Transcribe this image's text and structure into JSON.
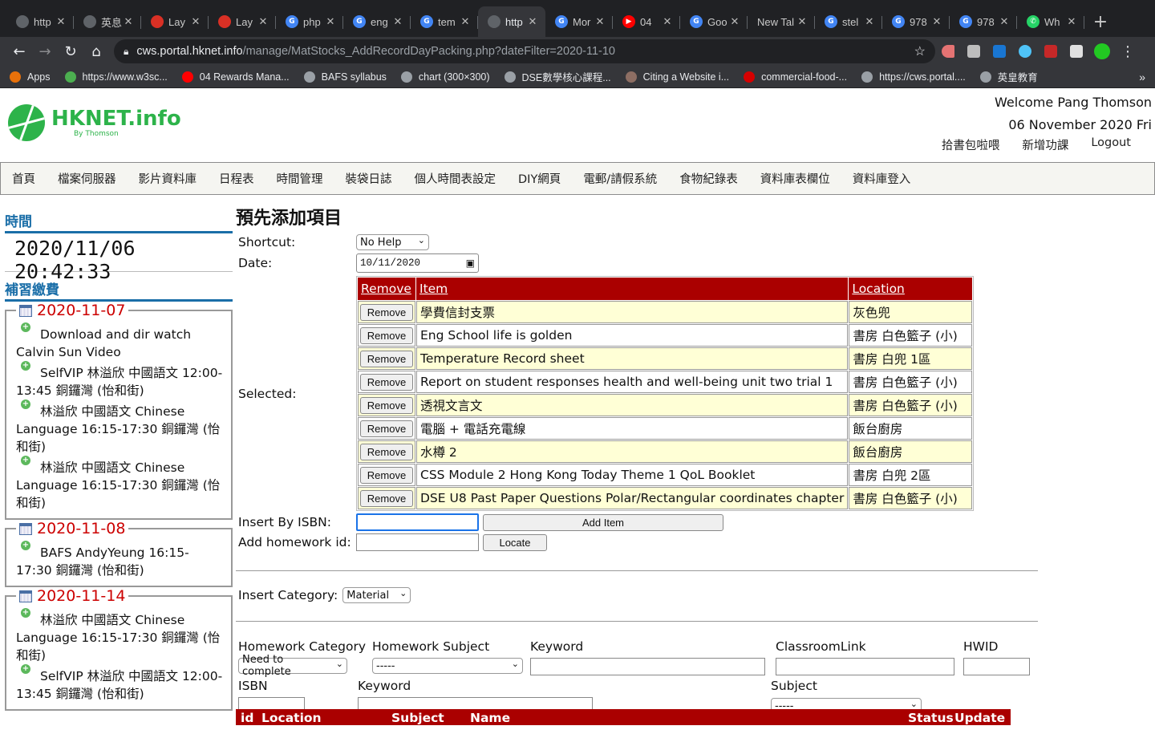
{
  "browser": {
    "tabs": [
      {
        "title": "http",
        "color": "#5f6368",
        "glyph": ""
      },
      {
        "title": "英息",
        "color": "#5f6368",
        "glyph": ""
      },
      {
        "title": "Lay",
        "color": "#d93025",
        "glyph": ""
      },
      {
        "title": "Lay",
        "color": "#d93025",
        "glyph": ""
      },
      {
        "title": "php",
        "color": "#4285f4",
        "glyph": "G"
      },
      {
        "title": "eng",
        "color": "#4285f4",
        "glyph": "G"
      },
      {
        "title": "tem",
        "color": "#4285f4",
        "glyph": "G"
      },
      {
        "title": "http",
        "color": "#5f6368",
        "glyph": ""
      },
      {
        "title": "Mor",
        "color": "#4285f4",
        "glyph": "G"
      },
      {
        "title": "04",
        "color": "#ff0000",
        "glyph": "▶"
      },
      {
        "title": "Goo",
        "color": "#4285f4",
        "glyph": "G"
      },
      {
        "title": "New Tal",
        "color": "",
        "glyph": ""
      },
      {
        "title": "stel",
        "color": "#4285f4",
        "glyph": "G"
      },
      {
        "title": "978",
        "color": "#4285f4",
        "glyph": "G"
      },
      {
        "title": "978",
        "color": "#4285f4",
        "glyph": "G"
      },
      {
        "title": "Wh",
        "color": "#25d366",
        "glyph": "✆"
      }
    ],
    "active_tab_index": 7,
    "url_host": "cws.portal.hknet.info",
    "url_path": "/manage/MatStocks_AddRecordDayPacking.php?dateFilter=2020-11-10",
    "bookmarks": [
      {
        "label": "Apps",
        "color": "#e8710a"
      },
      {
        "label": "https://www.w3sc...",
        "color": "#4caf50"
      },
      {
        "label": "04 Rewards Mana...",
        "color": "#ff0000"
      },
      {
        "label": "BAFS syllabus",
        "color": "#9aa0a6"
      },
      {
        "label": "chart (300×300)",
        "color": "#9aa0a6"
      },
      {
        "label": "DSE數學核心課程...",
        "color": "#9aa0a6"
      },
      {
        "label": "Citing a Website i...",
        "color": "#8d6e63"
      },
      {
        "label": "commercial-food-...",
        "color": "#d50000"
      },
      {
        "label": "https://cws.portal....",
        "color": "#9aa0a6"
      },
      {
        "label": "英皇教育",
        "color": "#9aa0a6"
      }
    ],
    "more": "»"
  },
  "header": {
    "logo_name": "HKNET.info",
    "logo_by": "By Thomson",
    "welcome": "Welcome Pang Thomson",
    "date": "06 November 2020 Fri",
    "links": [
      "拾書包啦喂",
      "新增功課",
      "Logout"
    ]
  },
  "nav": [
    "首頁",
    "檔案伺服器",
    "影片資料庫",
    "日程表",
    "時間管理",
    "裝袋日誌",
    "個人時間表設定",
    "DIY網頁",
    "電郵/請假系統",
    "食物紀錄表",
    "資料庫表欄位",
    "資料庫登入"
  ],
  "sidebar": {
    "time_heading": "時間",
    "clock": "2020/11/06 20:42:33",
    "fees_heading": "補習繳費",
    "groups": [
      {
        "date": "2020-11-07",
        "events": [
          "Download and dir watch Calvin Sun Video",
          "SelfVIP 林溢欣 中國語文 12:00-13:45 銅鑼灣 (怡和街)",
          "林溢欣 中國語文 Chinese Language 16:15-17:30 銅鑼灣 (怡和街)",
          "林溢欣 中國語文 Chinese Language 16:15-17:30 銅鑼灣 (怡和街)"
        ]
      },
      {
        "date": "2020-11-08",
        "events": [
          "BAFS AndyYeung 16:15-17:30 銅鑼灣 (怡和街)"
        ]
      },
      {
        "date": "2020-11-14",
        "events": [
          "林溢欣 中國語文 Chinese Language 16:15-17:30 銅鑼灣 (怡和街)",
          "SelfVIP 林溢欣 中國語文 12:00-13:45 銅鑼灣 (怡和街)"
        ]
      }
    ]
  },
  "main": {
    "title": "預先添加項目",
    "shortcut_label": "Shortcut:",
    "shortcut_value": "No Help",
    "date_label": "Date:",
    "date_value": "10/11/2020",
    "selected_label": "Selected:",
    "table_headers": {
      "remove": "Remove",
      "item": "Item",
      "location": "Location"
    },
    "remove_button": "Remove",
    "rows": [
      {
        "item": "學費信封支票",
        "location": "灰色兜"
      },
      {
        "item": "Eng School life is golden",
        "location": "書房 白色籃子 (小)"
      },
      {
        "item": "Temperature Record sheet",
        "location": "書房 白兜 1區"
      },
      {
        "item": "Report on student responses health and well-being unit two trial 1",
        "location": "書房 白色籃子 (小)"
      },
      {
        "item": "透視文言文",
        "location": "書房 白色籃子 (小)"
      },
      {
        "item": "電腦 + 電話充電線",
        "location": "飯台廚房"
      },
      {
        "item": "水樽 2",
        "location": "飯台廚房"
      },
      {
        "item": "CSS Module 2 Hong Kong Today Theme 1 QoL Booklet",
        "location": "書房 白兜 2區"
      },
      {
        "item": "DSE U8 Past Paper Questions Polar/Rectangular coordinates chapter",
        "location": "書房 白色籃子 (小)"
      }
    ],
    "isbn_label": "Insert By ISBN:",
    "add_item_button": "Add Item",
    "homework_label": "Add homework id:",
    "locate_button": "Locate",
    "category_label": "Insert Category:",
    "category_value": "Material",
    "filters": {
      "hw_category_label": "Homework Category",
      "hw_category_value": "Need to complete",
      "hw_subject_label": "Homework Subject",
      "hw_subject_value": "-----",
      "keyword_label": "Keyword",
      "classroom_label": "ClassroomLink",
      "hwid_label": "HWID",
      "isbn_label": "ISBN",
      "keyword2_label": "Keyword",
      "subject_label": "Subject",
      "subject_value": "-----"
    },
    "results_headers": [
      "id",
      "Location",
      "Subject",
      "Name",
      "Status",
      "Update"
    ]
  }
}
